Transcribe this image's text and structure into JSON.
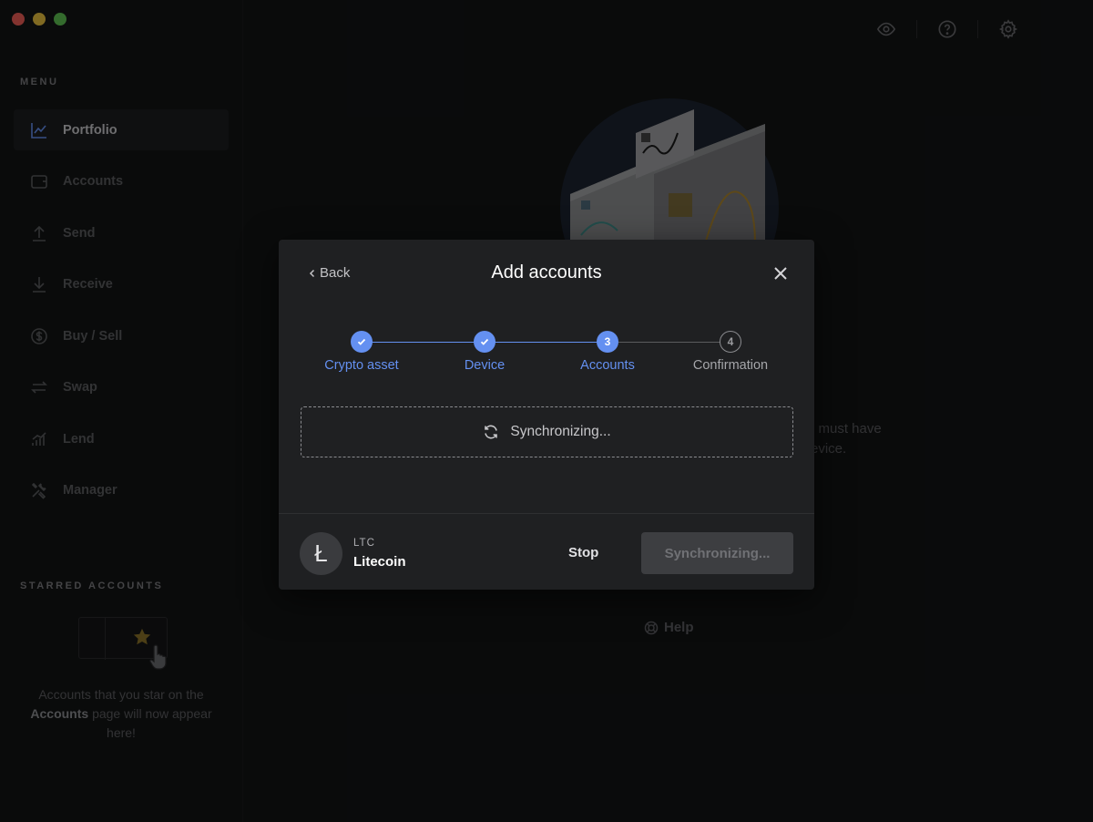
{
  "sidebar": {
    "menu_title": "MENU",
    "items": [
      {
        "label": "Portfolio",
        "icon": "chart-line-icon",
        "active": true
      },
      {
        "label": "Accounts",
        "icon": "wallet-icon"
      },
      {
        "label": "Send",
        "icon": "arrow-up-icon"
      },
      {
        "label": "Receive",
        "icon": "arrow-down-icon"
      },
      {
        "label": "Buy / Sell",
        "icon": "dollar-circle-icon"
      },
      {
        "label": "Swap",
        "icon": "swap-icon"
      },
      {
        "label": "Lend",
        "icon": "lend-chart-icon"
      },
      {
        "label": "Manager",
        "icon": "tools-icon"
      }
    ],
    "starred_title": "STARRED ACCOUNTS",
    "starred_text_1": "Accounts that you star on the",
    "starred_text_bold": "Accounts",
    "starred_text_2": "page will now appear here!"
  },
  "main": {
    "bg_text_1": "u must have",
    "bg_text_2": "evice.",
    "help_label": "Help"
  },
  "modal": {
    "back_label": "Back",
    "title": "Add accounts",
    "steps": [
      {
        "label": "Crypto asset",
        "state": "done"
      },
      {
        "label": "Device",
        "state": "done"
      },
      {
        "label": "Accounts",
        "state": "active",
        "number": "3"
      },
      {
        "label": "Confirmation",
        "state": "pending",
        "number": "4"
      }
    ],
    "sync_text": "Synchronizing...",
    "coin": {
      "ticker": "LTC",
      "name": "Litecoin",
      "symbol": "Ł"
    },
    "stop_label": "Stop",
    "sync_button_label": "Synchronizing..."
  },
  "colors": {
    "accent": "#6490f1",
    "background": "#131415",
    "modal_bg": "#1f2022"
  }
}
